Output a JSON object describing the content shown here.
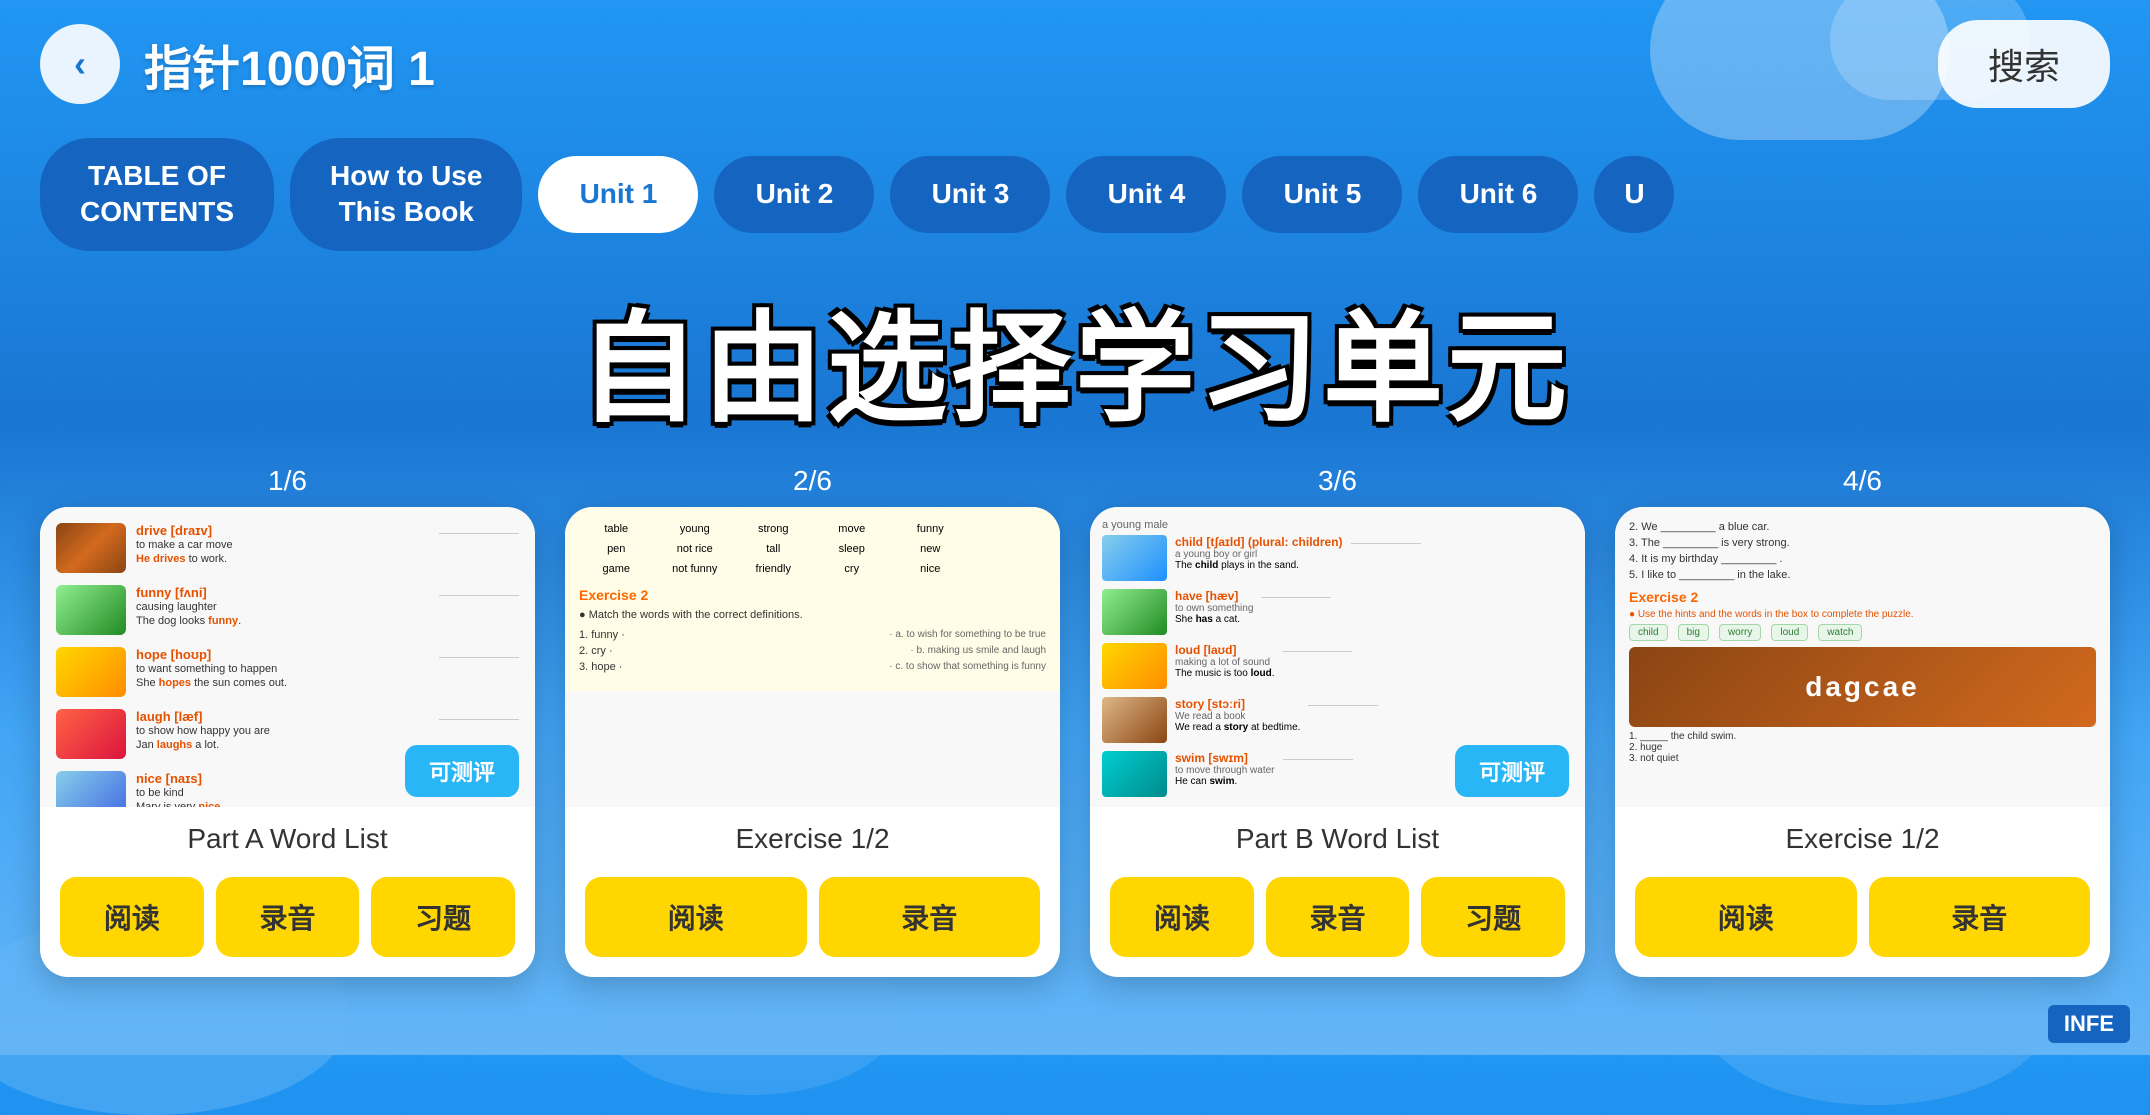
{
  "app": {
    "title": "指针1000词 1",
    "back_label": "‹",
    "search_label": "搜索"
  },
  "tabs": [
    {
      "id": "table-of-contents",
      "label": "TABLE OF\nCONTENTS",
      "active": false
    },
    {
      "id": "how-to-use",
      "label": "How to Use\nThis Book",
      "active": false
    },
    {
      "id": "unit1",
      "label": "Unit 1",
      "active": true
    },
    {
      "id": "unit2",
      "label": "Unit 2",
      "active": false
    },
    {
      "id": "unit3",
      "label": "Unit 3",
      "active": false
    },
    {
      "id": "unit4",
      "label": "Unit 4",
      "active": false
    },
    {
      "id": "unit5",
      "label": "Unit 5",
      "active": false
    },
    {
      "id": "unit6",
      "label": "Unit 6",
      "active": false
    },
    {
      "id": "unit_partial",
      "label": "U",
      "active": false
    }
  ],
  "main_title": "自由选择学习单元",
  "cards": [
    {
      "pagination": "1/6",
      "label": "Part A Word List",
      "assessable": true,
      "assessable_label": "可测评",
      "actions": [
        "阅读",
        "录音",
        "习题"
      ]
    },
    {
      "pagination": "2/6",
      "label": "Exercise 1/2",
      "assessable": false,
      "actions": [
        "阅读",
        "录音"
      ]
    },
    {
      "pagination": "3/6",
      "label": "Part B Word List",
      "assessable": true,
      "assessable_label": "可测评",
      "actions": [
        "阅读",
        "录音",
        "习题"
      ]
    },
    {
      "pagination": "4/6",
      "label": "Exercise 1/2",
      "assessable": false,
      "actions": [
        "阅读",
        "录音"
      ]
    }
  ],
  "watermark": "INFE"
}
